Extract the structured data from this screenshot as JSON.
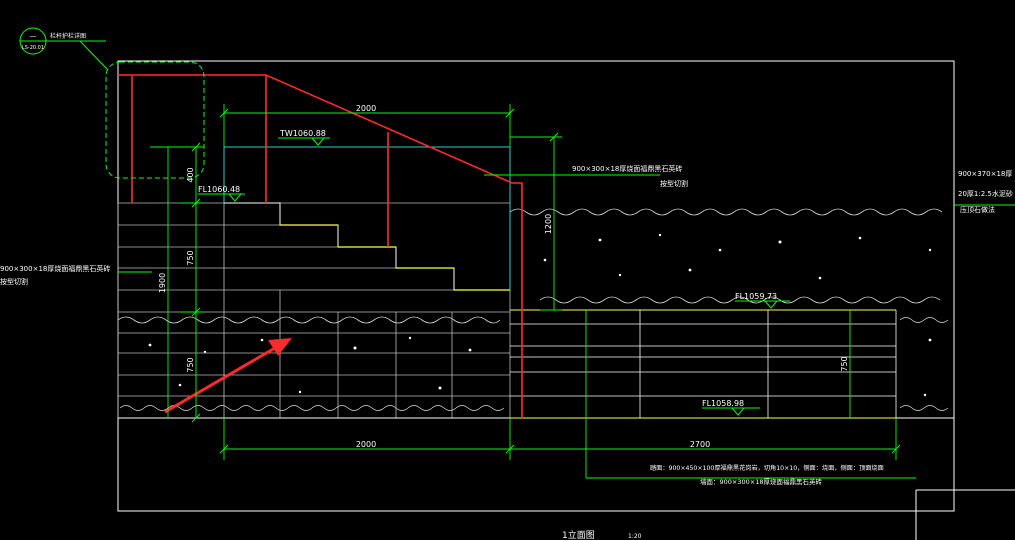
{
  "colors": {
    "background": "#000000",
    "frame": "#ffffff",
    "dimension": "#00ff00",
    "section": "#ff2a2a",
    "step_edge": "#ffff44",
    "cyan": "#33cccc",
    "grid": "#bdbdbd"
  },
  "callout": {
    "circle_top": "—",
    "circle_bottom": "LS-20.01",
    "label": "栏杆护栏详图"
  },
  "dimensions": {
    "top_2000": "2000",
    "bottom_2000": "2000",
    "bottom_2700": "2700",
    "v_1200": "1200",
    "v_400": "400",
    "v_750_upper": "750",
    "v_1900": "1900",
    "v_750_lower": "750",
    "v_750_right": "750"
  },
  "elevations": {
    "tw": "TW1060.88",
    "fl_upper": "FL1060.48",
    "fl_mid": "FL1059.73",
    "fl_low": "FL1058.98"
  },
  "notes": {
    "right_mid_1": "900×300×18厚烧面福鼎黑石英砖",
    "right_mid_2": "按型切割",
    "left_1": "900×300×18厚烧面福鼎黑石英砖",
    "left_2": "按型切割",
    "far_right_1": "900×370×18厚",
    "far_right_2": "20厚1:2.5水泥砂",
    "far_right_3": "压顶石做法",
    "bottom_1": "踏面：900×450×100厚福鼎黑花岗岩，切角10×10，侧面：烧面，侧面：顶面烧面",
    "bottom_2": "墙面：900×300×18厚烧面福鼎黑石英砖"
  },
  "title": {
    "name": "1立面图",
    "scale": "1:20"
  }
}
